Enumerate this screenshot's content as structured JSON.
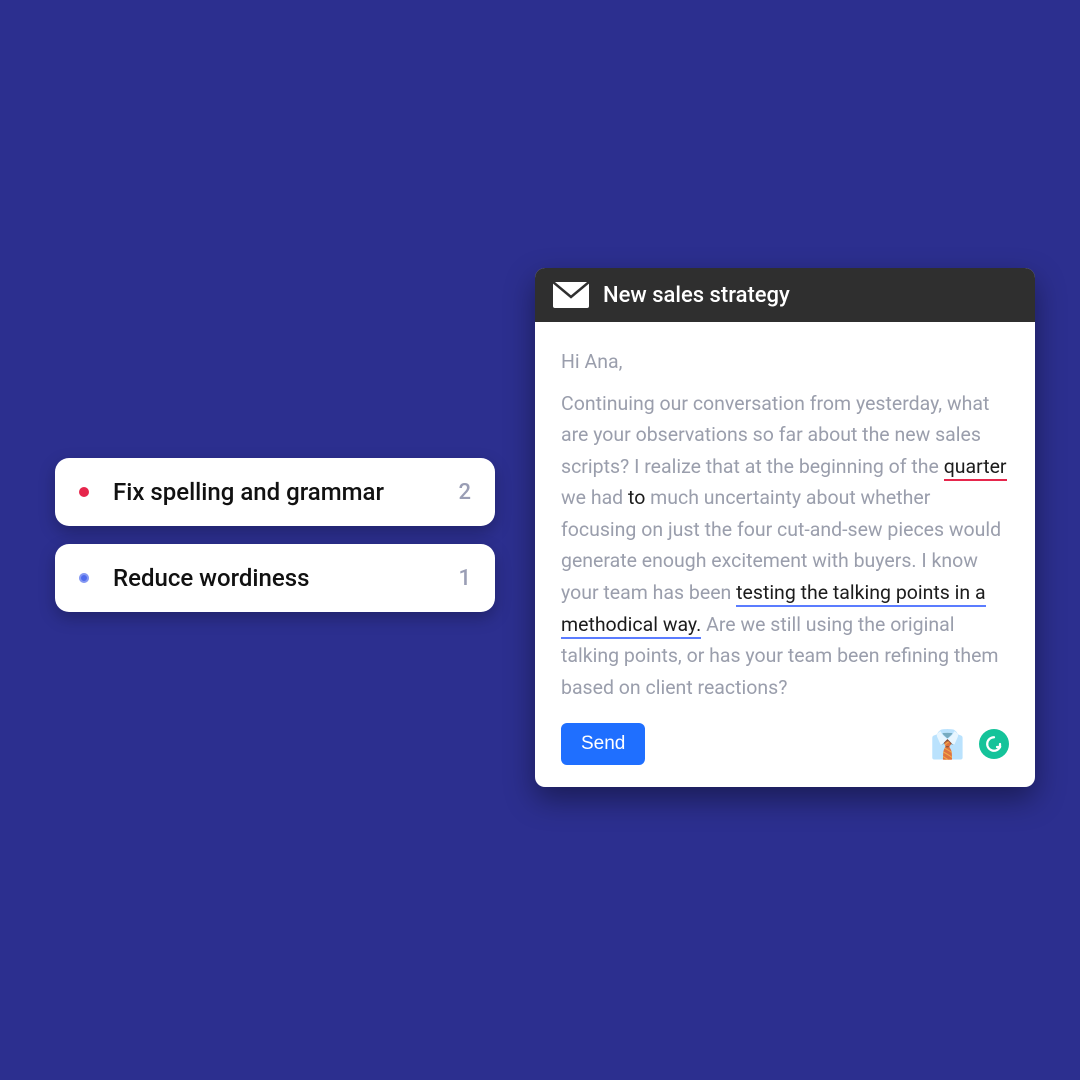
{
  "suggestions": [
    {
      "label": "Fix spelling and grammar",
      "count": "2",
      "dot_color": "red"
    },
    {
      "label": "Reduce wordiness",
      "count": "1",
      "dot_color": "blue"
    }
  ],
  "email": {
    "title": "New sales strategy",
    "greeting": "Hi Ana,",
    "body": {
      "p1_a": "Continuing our conversation from yesterday, what are your observations so far about the new sales scripts? I realize that at the beginning of the ",
      "p1_quarter": "quarter",
      "p1_b": " we had ",
      "p1_to": "to",
      "p1_c": " much uncertainty about whether focusing on just the four cut-and-sew pieces would generate enough excitement with buyers. I know your team has been ",
      "p1_testing": "testing the talking points in a methodical way.",
      "p1_d": " Are we still using the original talking points, or has your team been refining them based on client reactions?"
    },
    "send_label": "Send",
    "icons": {
      "shirt_emoji": "👔"
    }
  }
}
